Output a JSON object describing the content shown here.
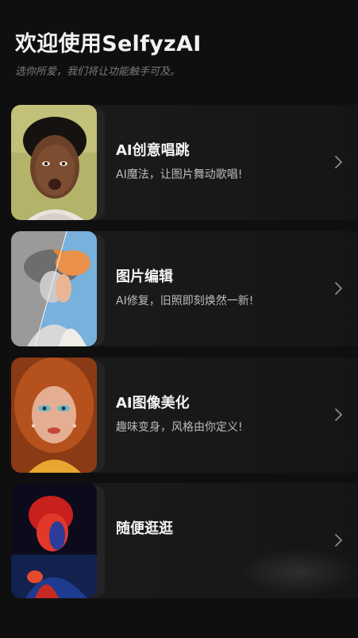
{
  "header": {
    "title": "欢迎使用SelfyzAI",
    "subtitle": "选你所爱，我们将让功能触手可及。"
  },
  "features": [
    {
      "title": "AI创意唱跳",
      "description": "AI魔法，让图片舞动歌唱!",
      "thumbnail": "portrait-smiling-man-icon"
    },
    {
      "title": "图片编辑",
      "description": "AI修复，旧照即刻焕然一新!",
      "thumbnail": "photo-restore-woman-hat-icon"
    },
    {
      "title": "AI图像美化",
      "description": "趣味变身，风格由你定义!",
      "thumbnail": "portrait-redhead-woman-icon"
    },
    {
      "title": "随便逛逛",
      "description": "",
      "thumbnail": "portrait-neon-man-icon"
    }
  ],
  "icons": {
    "row_arrow": "chevron-right-icon"
  },
  "colors": {
    "background": "#0f0f0f",
    "card": "#1a1a1a",
    "title_text": "#f2f2f2",
    "subtitle_text": "#7a7a7a",
    "desc_text": "#bdbdbd"
  }
}
